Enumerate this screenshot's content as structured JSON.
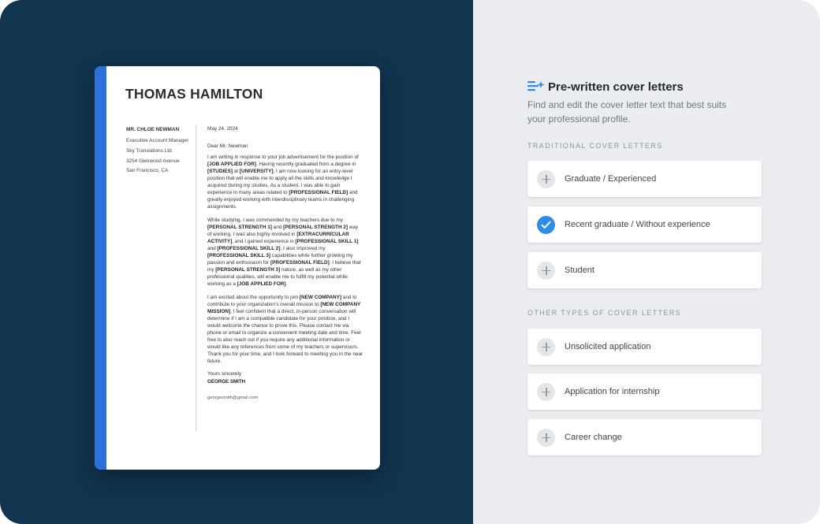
{
  "letter": {
    "name": "THOMAS HAMILTON",
    "recipient_name": "MR. CHLOE NEWMAN",
    "recipient_title": "Executive Account Manager",
    "recipient_company": "Sky Translations Ltd.",
    "recipient_street": "3254 Glenwood Avenue",
    "recipient_city": "San Francisco, CA",
    "date": "May 24, 2024",
    "greeting": "Dear Mr. Newman",
    "p1": [
      {
        "t": "I am writing in response to your job advertisement for the position of ",
        "b": false
      },
      {
        "t": "[JOB APPLIED FOR]",
        "b": true
      },
      {
        "t": ". Having recently graduated from a degree in ",
        "b": false
      },
      {
        "t": "[STUDIES]",
        "b": true
      },
      {
        "t": " at ",
        "b": false
      },
      {
        "t": "[UNIVERSITY]",
        "b": true
      },
      {
        "t": ", I am now looking for an entry-level position that will enable me to apply all the skills and knowledge I acquired during my studies. As a student, I was able to gain experience in many areas related to ",
        "b": false
      },
      {
        "t": "[PROFESSIONAL FIELD]",
        "b": true
      },
      {
        "t": " and greatly enjoyed working with interdisciplinary teams in challenging assignments.",
        "b": false
      }
    ],
    "p2": [
      {
        "t": "While studying, I was commended by my teachers due to my ",
        "b": false
      },
      {
        "t": "[PERSONAL STRENGTH 1]",
        "b": true
      },
      {
        "t": " and ",
        "b": false
      },
      {
        "t": "[PERSONAL STRENGTH 2]",
        "b": true
      },
      {
        "t": " way of working. I was also highly involved in ",
        "b": false
      },
      {
        "t": "[EXTRACURRICULAR ACTIVITY]",
        "b": true
      },
      {
        "t": ", and I gained experience in ",
        "b": false
      },
      {
        "t": "[PROFESSIONAL SKILL 1]",
        "b": true
      },
      {
        "t": " and ",
        "b": false
      },
      {
        "t": "[PROFESSIONAL SKILL 2]",
        "b": true
      },
      {
        "t": ". I also improved my ",
        "b": false
      },
      {
        "t": "[PROFESSIONAL SKILL 3]",
        "b": true
      },
      {
        "t": " capabilities while further growing my passion and enthusiasm for ",
        "b": false
      },
      {
        "t": "[PROFESSIONAL FIELD]",
        "b": true
      },
      {
        "t": ". I believe that my ",
        "b": false
      },
      {
        "t": "[PERSONAL STRENGTH 3]",
        "b": true
      },
      {
        "t": " nature, as well as my other professional qualities, will enable me to fulfill my potential while working as a ",
        "b": false
      },
      {
        "t": "[JOB APPLIED FOR]",
        "b": true
      },
      {
        "t": ".",
        "b": false
      }
    ],
    "p3": [
      {
        "t": "I am excited about the opportunity to join ",
        "b": false
      },
      {
        "t": "[NEW COMPANY]",
        "b": true
      },
      {
        "t": " and to contribute to your organization's overall mission to ",
        "b": false
      },
      {
        "t": "[NEW COMPANY MISSION]",
        "b": true
      },
      {
        "t": ". I feel confident that a direct, in-person conversation will determine if I am a compatible candidate for your position, and I would welcome the chance to prove this. Please contact me via phone or email to organize a convenient meeting date and time. Feel free to also reach out if you require any additional information or would like any references from some of my teachers or supervisors. Thank you for your time, and I look forward to meeting you in the near future.",
        "b": false
      }
    ],
    "closing": "Yours sincerely",
    "signature": "GEORGE SMITH",
    "email": "georgesmith@gmail.com"
  },
  "panel": {
    "title": "Pre-written cover letters",
    "subtitle": "Find and edit the cover letter text that best suits your professional profile.",
    "section1_label": "TRADITIONAL COVER LETTERS",
    "section2_label": "OTHER TYPES OF COVER LETTERS",
    "items": [
      {
        "label": "Graduate / Experienced",
        "selected": false
      },
      {
        "label": "Recent graduate / Without experience",
        "selected": true
      },
      {
        "label": "Student",
        "selected": false
      },
      {
        "label": "Unsolicited application",
        "selected": false
      },
      {
        "label": "Application for internship",
        "selected": false
      },
      {
        "label": "Career change",
        "selected": false
      }
    ]
  },
  "colors": {
    "left_bg": "#11344f",
    "right_bg": "#ebedf0",
    "accent_bar": "#2f6fd8",
    "check": "#2e8de5"
  },
  "icons": {
    "title": "text-sparkle-icon",
    "unselected": "plus-icon",
    "selected": "check-icon"
  }
}
